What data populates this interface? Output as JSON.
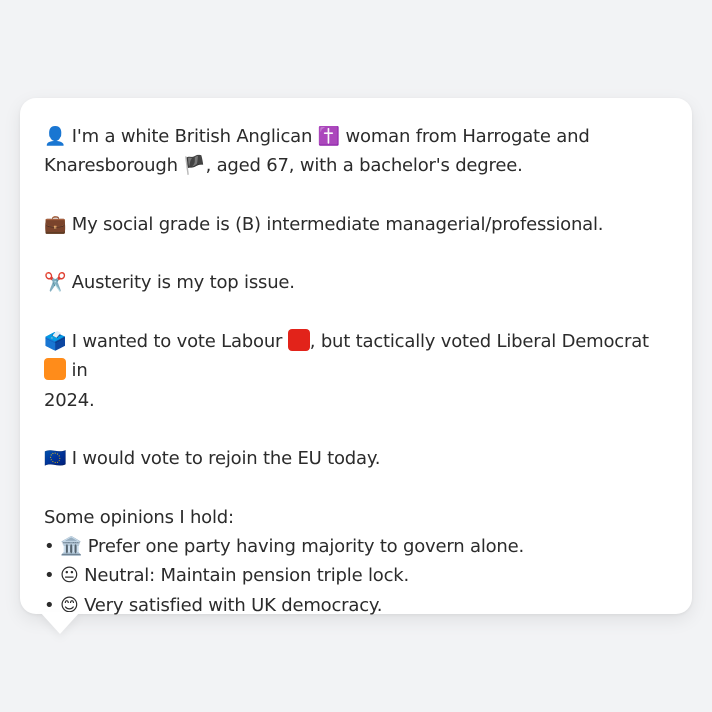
{
  "bubble": {
    "line1": {
      "icon": "👤",
      "part1": "I'm a white British Anglican",
      "icon2": "✝️",
      "part2": "woman from Harrogate and",
      "part3": "Knaresborough",
      "flag": "🏴",
      "part4": ", aged 67, with a bachelor's degree."
    },
    "line2": {
      "icon": "💼",
      "text": "My social grade is (B) intermediate managerial/professional."
    },
    "line3": {
      "icon": "✂️",
      "text": "Austerity is my top issue."
    },
    "line4": {
      "icon": "🗳️",
      "part1": "I wanted to vote Labour",
      "labour_color": "#e2231a",
      "part2": ", but tactically voted Liberal Democrat",
      "libdem_color": "#ff8c1a",
      "part3": "in",
      "part4": "2024."
    },
    "line5": {
      "icon": "🇪🇺",
      "text": "I would vote to rejoin the EU today."
    },
    "opinions_heading": "Some opinions I hold:",
    "opinions": [
      {
        "bullet": "•",
        "icon": "🏛️",
        "text": "Prefer one party having majority to govern alone."
      },
      {
        "bullet": "•",
        "icon": "😐",
        "text": "Neutral: Maintain pension triple lock."
      },
      {
        "bullet": "•",
        "icon": "😊",
        "text": "Very satisfied with UK democracy."
      }
    ]
  },
  "colors": {
    "background": "#f2f3f5",
    "bubble": "#ffffff",
    "text": "#2b2b2b"
  }
}
